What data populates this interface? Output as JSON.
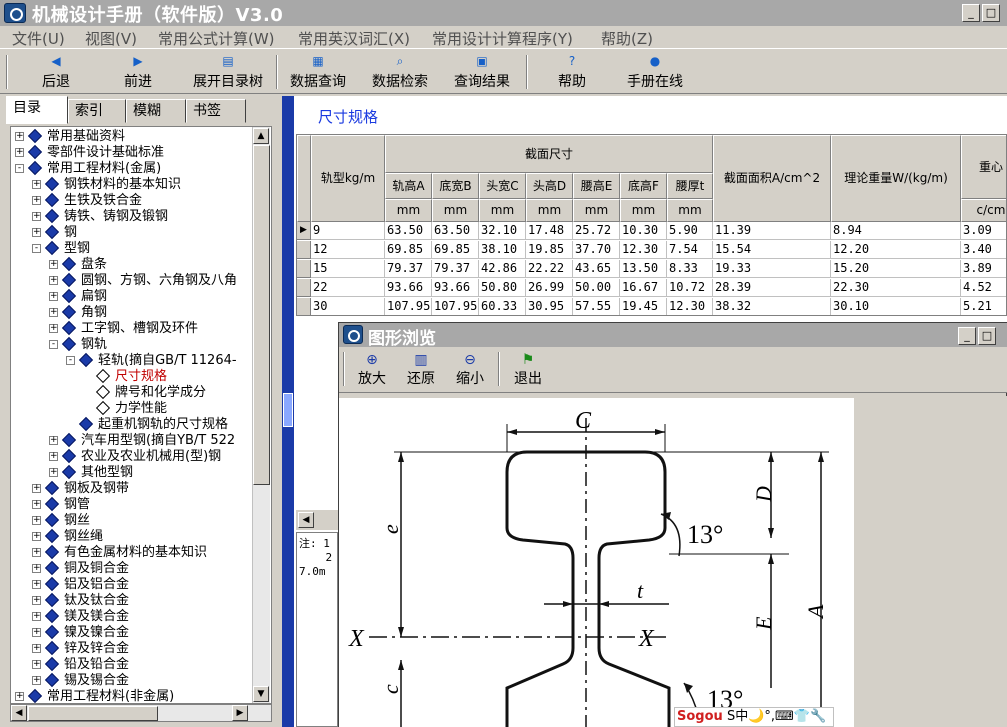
{
  "window": {
    "title": "机械设计手册（软件版）V3.0",
    "min_glyph": "_",
    "max_glyph": "□"
  },
  "menu": [
    "文件(U)",
    "视图(V)",
    "常用公式计算(W)",
    "常用英汉词汇(X)",
    "常用设计计算程序(Y)",
    "帮助(Z)"
  ],
  "toolbar": {
    "back": "后退",
    "forward": "前进",
    "expand_tree": "展开目录树",
    "data_query": "数据查询",
    "data_search": "数据检索",
    "query_result": "查询结果",
    "help": "帮助",
    "online": "手册在线"
  },
  "left_tabs": [
    "目录",
    "索引",
    "模糊",
    "书签"
  ],
  "tree": [
    {
      "level": 0,
      "exp": "+",
      "text": "常用基础资料"
    },
    {
      "level": 0,
      "exp": "+",
      "text": "零部件设计基础标准"
    },
    {
      "level": 0,
      "exp": "-",
      "text": "常用工程材料(金属)"
    },
    {
      "level": 1,
      "exp": "+",
      "text": "钢铁材料的基本知识"
    },
    {
      "level": 1,
      "exp": "+",
      "text": "生铁及铁合金"
    },
    {
      "level": 1,
      "exp": "+",
      "text": "铸铁、铸钢及锻钢"
    },
    {
      "level": 1,
      "exp": "+",
      "text": "钢"
    },
    {
      "level": 1,
      "exp": "-",
      "text": "型钢"
    },
    {
      "level": 2,
      "exp": "+",
      "text": "盘条"
    },
    {
      "level": 2,
      "exp": "+",
      "text": "圆钢、方钢、六角钢及八角"
    },
    {
      "level": 2,
      "exp": "+",
      "text": "扁钢"
    },
    {
      "level": 2,
      "exp": "+",
      "text": "角钢"
    },
    {
      "level": 2,
      "exp": "+",
      "text": "工字钢、槽钢及环件"
    },
    {
      "level": 2,
      "exp": "-",
      "text": "钢轨"
    },
    {
      "level": 3,
      "exp": "-",
      "text": "轻轨(摘自GB/T 11264-"
    },
    {
      "level": 4,
      "exp": "",
      "text": "尺寸规格",
      "selected": true
    },
    {
      "level": 4,
      "exp": "",
      "text": "牌号和化学成分"
    },
    {
      "level": 4,
      "exp": "",
      "text": "力学性能"
    },
    {
      "level": 3,
      "exp": "",
      "text": "起重机钢轨的尺寸规格"
    },
    {
      "level": 2,
      "exp": "+",
      "text": "汽车用型钢(摘自YB/T 522"
    },
    {
      "level": 2,
      "exp": "+",
      "text": "农业及农业机械用(型)钢"
    },
    {
      "level": 2,
      "exp": "+",
      "text": "其他型钢"
    },
    {
      "level": 1,
      "exp": "+",
      "text": "钢板及钢带"
    },
    {
      "level": 1,
      "exp": "+",
      "text": "钢管"
    },
    {
      "level": 1,
      "exp": "+",
      "text": "钢丝"
    },
    {
      "level": 1,
      "exp": "+",
      "text": "钢丝绳"
    },
    {
      "level": 1,
      "exp": "+",
      "text": "有色金属材料的基本知识"
    },
    {
      "level": 1,
      "exp": "+",
      "text": "铜及铜合金"
    },
    {
      "level": 1,
      "exp": "+",
      "text": "铝及铝合金"
    },
    {
      "level": 1,
      "exp": "+",
      "text": "钛及钛合金"
    },
    {
      "level": 1,
      "exp": "+",
      "text": "镁及镁合金"
    },
    {
      "level": 1,
      "exp": "+",
      "text": "镍及镍合金"
    },
    {
      "level": 1,
      "exp": "+",
      "text": "锌及锌合金"
    },
    {
      "level": 1,
      "exp": "+",
      "text": "铅及铅合金"
    },
    {
      "level": 1,
      "exp": "+",
      "text": "锡及锡合金"
    },
    {
      "level": 0,
      "exp": "+",
      "text": "常用工程材料(非金属)"
    }
  ],
  "spec": {
    "title": "尺寸规格",
    "headers": {
      "rail_type": "轨型kg/m",
      "section": "截面尺寸",
      "area": "截面面积A/cm^2",
      "weight": "理论重量W/(kg/m)",
      "centroid": "重心"
    },
    "subheaders": [
      "轨高A",
      "底宽B",
      "头宽C",
      "头高D",
      "腰高E",
      "底高F",
      "腰厚t"
    ],
    "units": [
      "mm",
      "mm",
      "mm",
      "mm",
      "mm",
      "mm",
      "mm"
    ],
    "centroid_unit": "c/cm",
    "rows": [
      [
        "9",
        "63.50",
        "63.50",
        "32.10",
        "17.48",
        "25.72",
        "10.30",
        "5.90",
        "11.39",
        "8.94",
        "3.09"
      ],
      [
        "12",
        "69.85",
        "69.85",
        "38.10",
        "19.85",
        "37.70",
        "12.30",
        "7.54",
        "15.54",
        "12.20",
        "3.40"
      ],
      [
        "15",
        "79.37",
        "79.37",
        "42.86",
        "22.22",
        "43.65",
        "13.50",
        "8.33",
        "19.33",
        "15.20",
        "3.89"
      ],
      [
        "22",
        "93.66",
        "93.66",
        "50.80",
        "26.99",
        "50.00",
        "16.67",
        "10.72",
        "28.39",
        "22.30",
        "4.52"
      ],
      [
        "30",
        "107.95",
        "107.95",
        "60.33",
        "30.95",
        "57.55",
        "19.45",
        "12.30",
        "38.32",
        "30.10",
        "5.21"
      ]
    ]
  },
  "note": "注: 1\n    2\n7.0m",
  "viewer": {
    "title": "图形浏览",
    "zoom_in": "放大",
    "restore": "还原",
    "zoom_out": "缩小",
    "exit": "退出"
  },
  "drawing_labels": {
    "C": "C",
    "D": "D",
    "e": "e",
    "A": "A",
    "E": "E",
    "angle1": "13°",
    "angle2": "13°",
    "t": "t",
    "X1": "X",
    "X2": "X",
    "c": "c"
  },
  "ime": "S中🌙°,⌨👕🔧"
}
